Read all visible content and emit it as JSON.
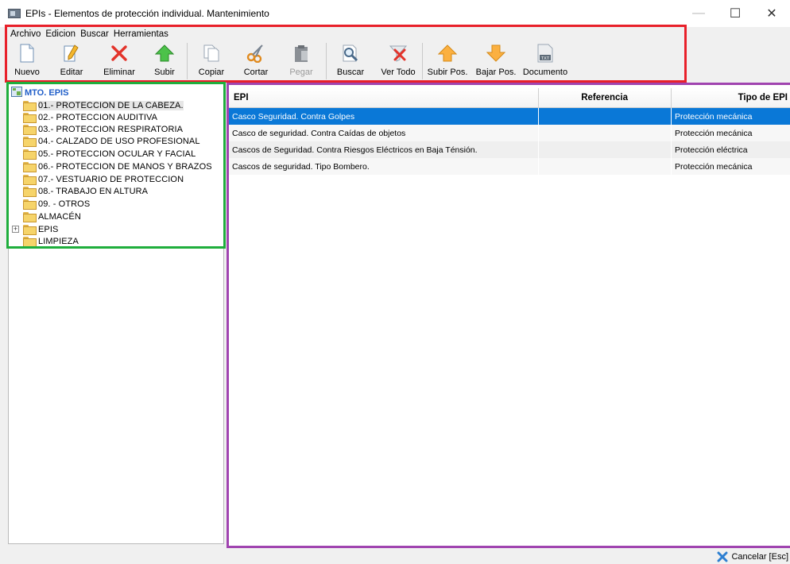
{
  "window": {
    "title": "EPIs - Elementos de protección individual. Mantenimiento",
    "controls": {
      "minimize": "—",
      "maximize": "☐",
      "close": "✕"
    }
  },
  "menu": [
    "Archivo",
    "Edicion",
    "Buscar",
    "Herramientas"
  ],
  "toolbar": {
    "nuevo": "Nuevo",
    "editar": "Editar",
    "eliminar": "Eliminar",
    "subir": "Subir",
    "copiar": "Copiar",
    "cortar": "Cortar",
    "pegar": "Pegar",
    "buscar": "Buscar",
    "ver_todo": "Ver Todo",
    "subir_pos": "Subir Pos.",
    "bajar_pos": "Bajar Pos.",
    "documento": "Documento",
    "txt_badge": "TXT"
  },
  "tree": {
    "root": "MTO. EPIS",
    "nodes": [
      "01.- PROTECCION DE LA CABEZA.",
      "02.- PROTECCION AUDITIVA",
      "03.- PROTECCION RESPIRATORIA",
      "04.- CALZADO DE USO PROFESIONAL",
      "05.- PROTECCION OCULAR Y FACIAL",
      "06.- PROTECCION DE MANOS Y BRAZOS",
      "07.- VESTUARIO DE PROTECCION",
      "08.- TRABAJO EN ALTURA",
      "09. - OTROS",
      "ALMACÉN",
      "EPIS",
      "LIMPIEZA"
    ],
    "expander": "+"
  },
  "grid": {
    "columns": [
      "EPI",
      "Referencia",
      "Tipo de EPI"
    ],
    "rows": [
      [
        "Casco Seguridad. Contra Golpes",
        "",
        "Protección mecánica"
      ],
      [
        "Casco de seguridad. Contra Caídas de objetos",
        "",
        "Protección mecánica"
      ],
      [
        "Cascos de Seguridad. Contra Riesgos Eléctricos en Baja Ténsión.",
        "",
        "Protección eléctrica"
      ],
      [
        "Cascos de seguridad. Tipo Bombero.",
        "",
        "Protección mecánica"
      ]
    ]
  },
  "status": {
    "cancel": "Cancelar  [Esc]"
  }
}
